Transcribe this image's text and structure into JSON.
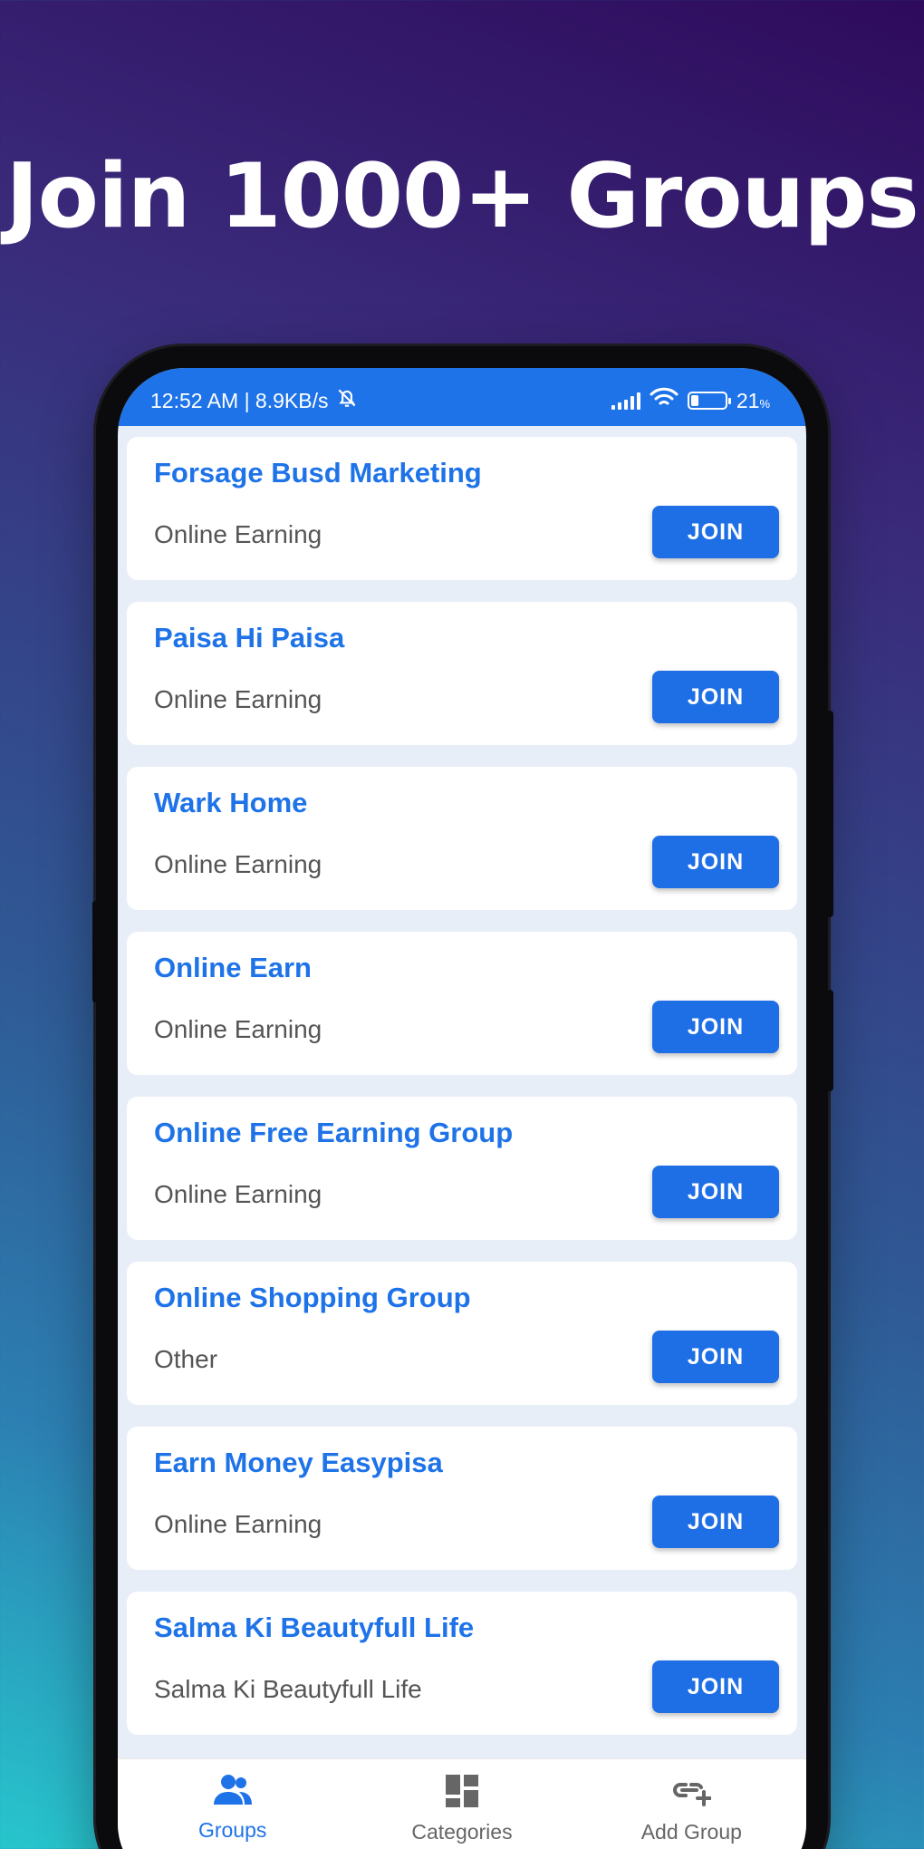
{
  "headline": "Join 1000+ Groups",
  "status_bar": {
    "time_speed": "12:52 AM | 8.9KB/s",
    "battery_percent": "21",
    "battery_unit": "%"
  },
  "groups": [
    {
      "title": "Forsage Busd Marketing",
      "category": "Online Earning",
      "button": "JOIN"
    },
    {
      "title": "Paisa Hi Paisa",
      "category": "Online Earning",
      "button": "JOIN"
    },
    {
      "title": "Wark Home",
      "category": "Online Earning",
      "button": "JOIN"
    },
    {
      "title": "Online Earn",
      "category": "Online Earning",
      "button": "JOIN"
    },
    {
      "title": "Online Free Earning Group",
      "category": "Online Earning",
      "button": "JOIN"
    },
    {
      "title": "Online Shopping Group",
      "category": "Other",
      "button": "JOIN"
    },
    {
      "title": "Earn Money Easypisa",
      "category": "Online Earning",
      "button": "JOIN"
    },
    {
      "title": "Salma Ki Beautyfull Life",
      "category": "Salma Ki Beautyfull Life",
      "button": "JOIN"
    }
  ],
  "bottom_nav": {
    "items": [
      {
        "label": "Groups",
        "icon": "groups-icon",
        "active": true
      },
      {
        "label": "Categories",
        "icon": "categories-icon",
        "active": false
      },
      {
        "label": "Add Group",
        "icon": "add-group-icon",
        "active": false
      }
    ]
  },
  "colors": {
    "accent": "#1e73e8",
    "status_bar": "#1e73e8",
    "list_background": "#e8eef8",
    "inactive_nav": "#666666"
  }
}
